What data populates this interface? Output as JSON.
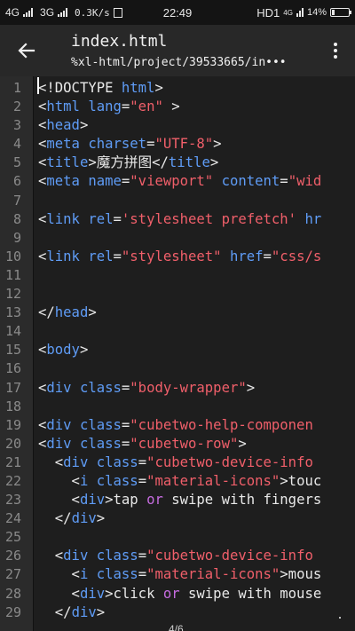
{
  "status_bar": {
    "net1": "4G",
    "net2": "3G",
    "speed": "0.3K/s",
    "time": "22:49",
    "hd": "HD1",
    "tech": "4G",
    "battery_pct": "14%",
    "battery_level": 0.14
  },
  "app_bar": {
    "title": "index.html",
    "path": "%xl-html/project/39533665/in•••"
  },
  "editor": {
    "page_indicator": "4/6",
    "lines": [
      {
        "n": "1",
        "tokens": [
          {
            "t": "<!DOCTYPE ",
            "c": "txt"
          },
          {
            "t": "html",
            "c": "tag"
          },
          {
            "t": ">",
            "c": "txt"
          }
        ]
      },
      {
        "n": "2",
        "tokens": [
          {
            "t": "<",
            "c": "txt"
          },
          {
            "t": "html",
            "c": "tag"
          },
          {
            "t": " ",
            "c": "txt"
          },
          {
            "t": "lang",
            "c": "attr"
          },
          {
            "t": "=",
            "c": "txt"
          },
          {
            "t": "\"en\"",
            "c": "str"
          },
          {
            "t": " >",
            "c": "txt"
          }
        ]
      },
      {
        "n": "3",
        "tokens": [
          {
            "t": "<",
            "c": "txt"
          },
          {
            "t": "head",
            "c": "tag"
          },
          {
            "t": ">",
            "c": "txt"
          }
        ]
      },
      {
        "n": "4",
        "tokens": [
          {
            "t": "<",
            "c": "txt"
          },
          {
            "t": "meta",
            "c": "tag"
          },
          {
            "t": " ",
            "c": "txt"
          },
          {
            "t": "charset",
            "c": "attr"
          },
          {
            "t": "=",
            "c": "txt"
          },
          {
            "t": "\"UTF-8\"",
            "c": "str"
          },
          {
            "t": ">",
            "c": "txt"
          }
        ]
      },
      {
        "n": "5",
        "tokens": [
          {
            "t": "<",
            "c": "txt"
          },
          {
            "t": "title",
            "c": "tag"
          },
          {
            "t": ">魔方拼图</",
            "c": "txt"
          },
          {
            "t": "title",
            "c": "tag"
          },
          {
            "t": ">",
            "c": "txt"
          }
        ]
      },
      {
        "n": "6",
        "tokens": [
          {
            "t": "<",
            "c": "txt"
          },
          {
            "t": "meta",
            "c": "tag"
          },
          {
            "t": " ",
            "c": "txt"
          },
          {
            "t": "name",
            "c": "attr"
          },
          {
            "t": "=",
            "c": "txt"
          },
          {
            "t": "\"viewport\"",
            "c": "str"
          },
          {
            "t": " ",
            "c": "txt"
          },
          {
            "t": "content",
            "c": "attr"
          },
          {
            "t": "=",
            "c": "txt"
          },
          {
            "t": "\"wid",
            "c": "str"
          }
        ]
      },
      {
        "n": "7",
        "tokens": []
      },
      {
        "n": "8",
        "tokens": [
          {
            "t": "<",
            "c": "txt"
          },
          {
            "t": "link",
            "c": "tag"
          },
          {
            "t": " ",
            "c": "txt"
          },
          {
            "t": "rel",
            "c": "attr"
          },
          {
            "t": "=",
            "c": "txt"
          },
          {
            "t": "'stylesheet prefetch'",
            "c": "str"
          },
          {
            "t": " ",
            "c": "txt"
          },
          {
            "t": "hr",
            "c": "attr"
          }
        ]
      },
      {
        "n": "9",
        "tokens": []
      },
      {
        "n": "10",
        "tokens": [
          {
            "t": "<",
            "c": "txt"
          },
          {
            "t": "link",
            "c": "tag"
          },
          {
            "t": " ",
            "c": "txt"
          },
          {
            "t": "rel",
            "c": "attr"
          },
          {
            "t": "=",
            "c": "txt"
          },
          {
            "t": "\"stylesheet\"",
            "c": "str"
          },
          {
            "t": " ",
            "c": "txt"
          },
          {
            "t": "href",
            "c": "attr"
          },
          {
            "t": "=",
            "c": "txt"
          },
          {
            "t": "\"css/s",
            "c": "str"
          }
        ]
      },
      {
        "n": "11",
        "tokens": []
      },
      {
        "n": "12",
        "tokens": []
      },
      {
        "n": "13",
        "tokens": [
          {
            "t": "</",
            "c": "txt"
          },
          {
            "t": "head",
            "c": "tag"
          },
          {
            "t": ">",
            "c": "txt"
          }
        ]
      },
      {
        "n": "14",
        "tokens": []
      },
      {
        "n": "15",
        "tokens": [
          {
            "t": "<",
            "c": "txt"
          },
          {
            "t": "body",
            "c": "tag"
          },
          {
            "t": ">",
            "c": "txt"
          }
        ]
      },
      {
        "n": "16",
        "tokens": []
      },
      {
        "n": "17",
        "tokens": [
          {
            "t": "<",
            "c": "txt"
          },
          {
            "t": "div",
            "c": "tag"
          },
          {
            "t": " ",
            "c": "txt"
          },
          {
            "t": "class",
            "c": "attr"
          },
          {
            "t": "=",
            "c": "txt"
          },
          {
            "t": "\"body-wrapper\"",
            "c": "str"
          },
          {
            "t": ">",
            "c": "txt"
          }
        ]
      },
      {
        "n": "18",
        "tokens": []
      },
      {
        "n": "19",
        "tokens": [
          {
            "t": "<",
            "c": "txt"
          },
          {
            "t": "div",
            "c": "tag"
          },
          {
            "t": " ",
            "c": "txt"
          },
          {
            "t": "class",
            "c": "attr"
          },
          {
            "t": "=",
            "c": "txt"
          },
          {
            "t": "\"cubetwo-help-componen",
            "c": "str"
          }
        ]
      },
      {
        "n": "20",
        "tokens": [
          {
            "t": "<",
            "c": "txt"
          },
          {
            "t": "div",
            "c": "tag"
          },
          {
            "t": " ",
            "c": "txt"
          },
          {
            "t": "class",
            "c": "attr"
          },
          {
            "t": "=",
            "c": "txt"
          },
          {
            "t": "\"cubetwo-row\"",
            "c": "str"
          },
          {
            "t": ">",
            "c": "txt"
          }
        ]
      },
      {
        "n": "21",
        "tokens": [
          {
            "t": "  <",
            "c": "txt"
          },
          {
            "t": "div",
            "c": "tag"
          },
          {
            "t": " ",
            "c": "txt"
          },
          {
            "t": "class",
            "c": "attr"
          },
          {
            "t": "=",
            "c": "txt"
          },
          {
            "t": "\"cubetwo-device-info",
            "c": "str"
          }
        ]
      },
      {
        "n": "22",
        "tokens": [
          {
            "t": "    <",
            "c": "txt"
          },
          {
            "t": "i",
            "c": "tag"
          },
          {
            "t": " ",
            "c": "txt"
          },
          {
            "t": "class",
            "c": "attr"
          },
          {
            "t": "=",
            "c": "txt"
          },
          {
            "t": "\"material-icons\"",
            "c": "str"
          },
          {
            "t": ">touc",
            "c": "txt"
          }
        ]
      },
      {
        "n": "23",
        "tokens": [
          {
            "t": "    <",
            "c": "txt"
          },
          {
            "t": "div",
            "c": "tag"
          },
          {
            "t": ">tap ",
            "c": "txt"
          },
          {
            "t": "or",
            "c": "kw"
          },
          {
            "t": " swipe with fingers",
            "c": "txt"
          }
        ]
      },
      {
        "n": "24",
        "tokens": [
          {
            "t": "  </",
            "c": "txt"
          },
          {
            "t": "div",
            "c": "tag"
          },
          {
            "t": ">",
            "c": "txt"
          }
        ]
      },
      {
        "n": "25",
        "tokens": []
      },
      {
        "n": "26",
        "tokens": [
          {
            "t": "  <",
            "c": "txt"
          },
          {
            "t": "div",
            "c": "tag"
          },
          {
            "t": " ",
            "c": "txt"
          },
          {
            "t": "class",
            "c": "attr"
          },
          {
            "t": "=",
            "c": "txt"
          },
          {
            "t": "\"cubetwo-device-info",
            "c": "str"
          }
        ]
      },
      {
        "n": "27",
        "tokens": [
          {
            "t": "    <",
            "c": "txt"
          },
          {
            "t": "i",
            "c": "tag"
          },
          {
            "t": " ",
            "c": "txt"
          },
          {
            "t": "class",
            "c": "attr"
          },
          {
            "t": "=",
            "c": "txt"
          },
          {
            "t": "\"material-icons\"",
            "c": "str"
          },
          {
            "t": ">mous",
            "c": "txt"
          }
        ]
      },
      {
        "n": "28",
        "tokens": [
          {
            "t": "    <",
            "c": "txt"
          },
          {
            "t": "div",
            "c": "tag"
          },
          {
            "t": ">click ",
            "c": "txt"
          },
          {
            "t": "or",
            "c": "kw"
          },
          {
            "t": " swipe with mouse",
            "c": "txt"
          }
        ]
      },
      {
        "n": "29",
        "tokens": [
          {
            "t": "  </",
            "c": "txt"
          },
          {
            "t": "div",
            "c": "tag"
          },
          {
            "t": ">",
            "c": "txt"
          }
        ]
      }
    ]
  }
}
